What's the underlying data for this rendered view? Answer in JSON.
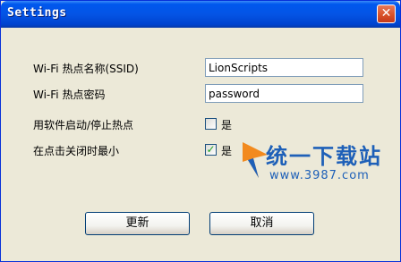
{
  "window": {
    "title": "Settings",
    "close_glyph": "✕"
  },
  "form": {
    "ssid_label": "Wi-Fi 热点名称(SSID)",
    "ssid_value": "LionScripts",
    "password_label": "Wi-Fi 热点密码",
    "password_value": "password",
    "use_software_label": "用软件启动/停止热点",
    "use_software_checked": false,
    "use_software_option": "是",
    "minimize_label": "在点击关闭时最小",
    "minimize_checked": true,
    "minimize_option": "是"
  },
  "buttons": {
    "update_label": "更新",
    "cancel_label": "取消"
  },
  "watermark": {
    "brand": "统一下载站",
    "url": "www.3987.com"
  },
  "colors": {
    "title_bar": "#0054E3",
    "close_button": "#D9532A",
    "window_bg": "#ECE9D8",
    "check": "#21A121"
  },
  "icons": {
    "close": "close-icon",
    "check": "check-icon",
    "logo": "logo-icon"
  }
}
